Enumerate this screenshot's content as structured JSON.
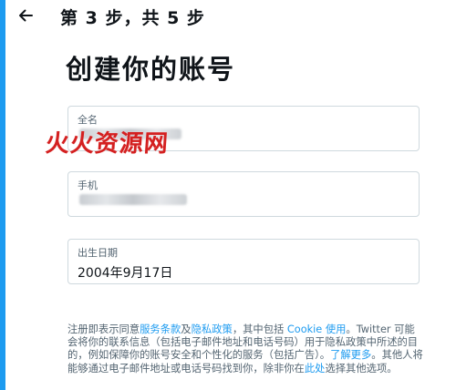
{
  "header": {
    "back_icon": "arrow-left-icon",
    "step_title": "第 3 步，共 5 步"
  },
  "main": {
    "title": "创建你的账号",
    "fields": {
      "name": {
        "label": "全名",
        "value": ""
      },
      "phone": {
        "label": "手机",
        "value": ""
      },
      "birthday": {
        "label": "出生日期",
        "value": "2004年9月17日"
      }
    }
  },
  "watermark": {
    "text": "火火资源网"
  },
  "legal": {
    "t1": "注册即表示同意",
    "link_terms": "服务条款",
    "t2": "及",
    "link_privacy": "隐私政策",
    "t3": "，其中包括 ",
    "link_cookie": "Cookie 使用",
    "t4": "。Twitter 可能会将你的联系信息（包括电子邮件地址和电话号码）用于隐私政策中所述的目的，例如保障你的账号安全和个性化的服务（包括广告）。",
    "link_learn": "了解更多",
    "t5": "。其他人将能够通过电子邮件地址或电话号码找到你，除非你在",
    "link_here": "此处",
    "t6": "选择其他选项。"
  },
  "colors": {
    "accent": "#1d9bf0",
    "text_primary": "#0f1419",
    "text_secondary": "#536471",
    "border": "#cfd9de",
    "watermark": "#d42020"
  }
}
